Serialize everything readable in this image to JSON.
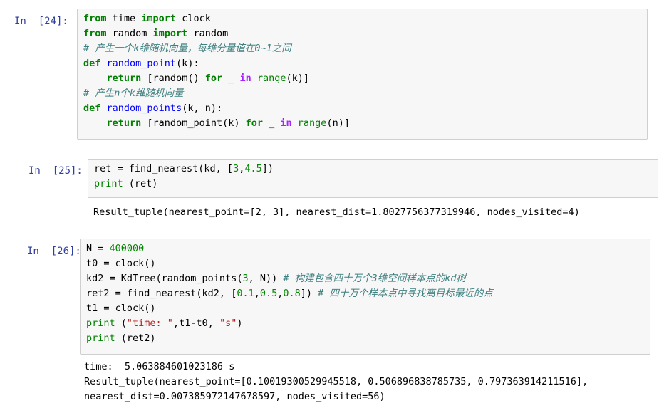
{
  "cells": [
    {
      "prompt": "In  [24]:",
      "code": [
        [
          [
            "kw",
            "from"
          ],
          [
            "t",
            " time "
          ],
          [
            "kw",
            "import"
          ],
          [
            "t",
            " clock"
          ]
        ],
        [
          [
            "kw",
            "from"
          ],
          [
            "t",
            " random "
          ],
          [
            "kw",
            "import"
          ],
          [
            "t",
            " random"
          ]
        ],
        [
          [
            "cm",
            "# 产生一个k维随机向量，每维分量值在0~1之间"
          ]
        ],
        [
          [
            "kw",
            "def"
          ],
          [
            "t",
            " "
          ],
          [
            "fn",
            "random_point"
          ],
          [
            "t",
            "(k):"
          ]
        ],
        [
          [
            "t",
            "    "
          ],
          [
            "kw",
            "return"
          ],
          [
            "t",
            " [random() "
          ],
          [
            "kw",
            "for"
          ],
          [
            "t",
            " _ "
          ],
          [
            "op",
            "in"
          ],
          [
            "t",
            " "
          ],
          [
            "bi",
            "range"
          ],
          [
            "t",
            "(k)]"
          ]
        ],
        [
          [
            "cm",
            "# 产生n个k维随机向量"
          ]
        ],
        [
          [
            "kw",
            "def"
          ],
          [
            "t",
            " "
          ],
          [
            "fn",
            "random_points"
          ],
          [
            "t",
            "(k, n):"
          ]
        ],
        [
          [
            "t",
            "    "
          ],
          [
            "kw",
            "return"
          ],
          [
            "t",
            " [random_point(k) "
          ],
          [
            "kw",
            "for"
          ],
          [
            "t",
            " _ "
          ],
          [
            "op",
            "in"
          ],
          [
            "t",
            " "
          ],
          [
            "bi",
            "range"
          ],
          [
            "t",
            "(n)]"
          ]
        ]
      ],
      "output": []
    },
    {
      "prompt": "In  [25]:",
      "code": [
        [
          [
            "t",
            "ret = find_nearest(kd, ["
          ],
          [
            "num",
            "3"
          ],
          [
            "t",
            ","
          ],
          [
            "num",
            "4.5"
          ],
          [
            "t",
            "])"
          ]
        ],
        [
          [
            "bi",
            "print"
          ],
          [
            "t",
            " (ret)"
          ]
        ]
      ],
      "output": [
        "Result_tuple(nearest_point=[2, 3], nearest_dist=1.8027756377319946, nodes_visited=4)"
      ]
    },
    {
      "prompt": "In  [26]:",
      "code": [
        [
          [
            "t",
            "N = "
          ],
          [
            "num",
            "400000"
          ]
        ],
        [
          [
            "t",
            "t0 = clock()"
          ]
        ],
        [
          [
            "t",
            "kd2 = KdTree(random_points("
          ],
          [
            "num",
            "3"
          ],
          [
            "t",
            ", N)) "
          ],
          [
            "cm",
            "# 构建包含四十万个3维空间样本点的kd树"
          ]
        ],
        [
          [
            "t",
            "ret2 = find_nearest(kd2, ["
          ],
          [
            "num",
            "0.1"
          ],
          [
            "t",
            ","
          ],
          [
            "num",
            "0.5"
          ],
          [
            "t",
            ","
          ],
          [
            "num",
            "0.8"
          ],
          [
            "t",
            "]) "
          ],
          [
            "cm",
            "# 四十万个样本点中寻找离目标最近的点"
          ]
        ],
        [
          [
            "t",
            "t1 = clock()"
          ]
        ],
        [
          [
            "bi",
            "print"
          ],
          [
            "t",
            " ("
          ],
          [
            "str",
            "\"time: \""
          ],
          [
            "t",
            ",t1"
          ],
          [
            "op",
            "-"
          ],
          [
            "t",
            "t0, "
          ],
          [
            "str",
            "\"s\""
          ],
          [
            "t",
            ")"
          ]
        ],
        [
          [
            "bi",
            "print"
          ],
          [
            "t",
            " (ret2)"
          ]
        ]
      ],
      "output": [
        "time:  5.063884601023186 s",
        "Result_tuple(nearest_point=[0.10019300529945518, 0.506896838785735, 0.797363914211516],",
        "nearest_dist=0.007385972147678597, nodes_visited=56)"
      ]
    }
  ]
}
